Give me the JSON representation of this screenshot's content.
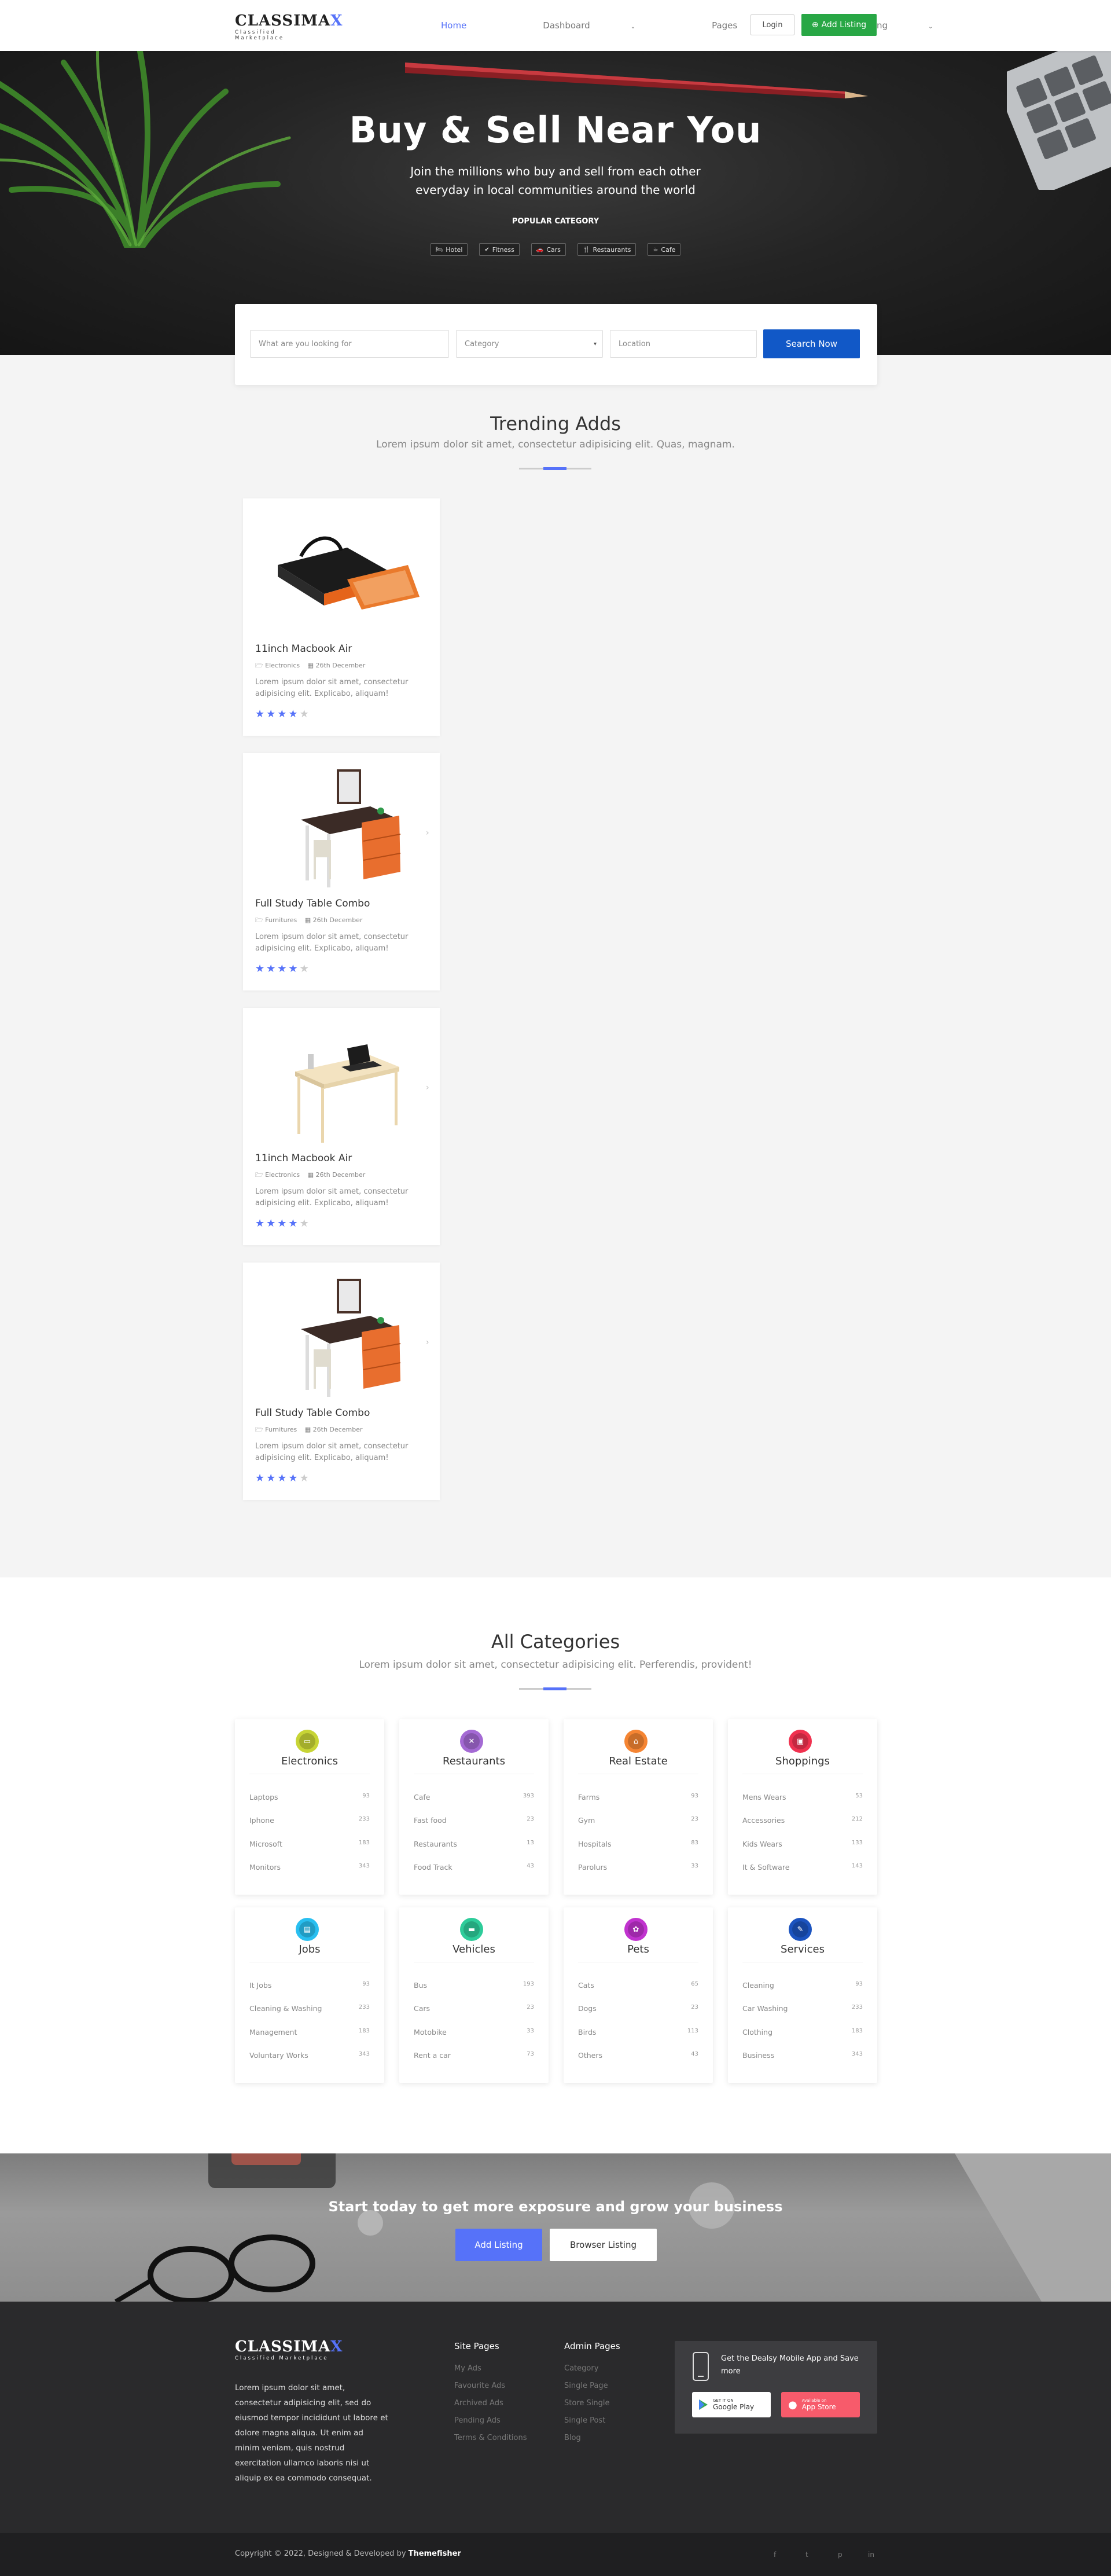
{
  "nav": {
    "logo_main": "CLASSIMA",
    "logo_x": "X",
    "logo_tagline": "Classified Marketplace",
    "items": [
      {
        "label": "Home",
        "caret": ""
      },
      {
        "label": "Dashboard",
        "caret": "⌄"
      },
      {
        "label": "Pages",
        "caret": "⌄"
      },
      {
        "label": "Listing",
        "caret": "⌄"
      }
    ],
    "login": "Login",
    "add_listing": "Add Listing",
    "add_icon": "⊕"
  },
  "hero": {
    "title": "Buy & Sell Near You",
    "subtitle": "Join the millions who buy and sell from each other everyday in local communities around the world",
    "popular_label": "POPULAR CATEGORY",
    "chips": [
      {
        "icon": "🛏",
        "label": "Hotel"
      },
      {
        "icon": "✔",
        "label": "Fitness"
      },
      {
        "icon": "🚗",
        "label": "Cars"
      },
      {
        "icon": "🍴",
        "label": "Restaurants"
      },
      {
        "icon": "☕",
        "label": "Cafe"
      }
    ]
  },
  "search": {
    "keyword_placeholder": "What are you looking for",
    "category_value": "Category",
    "location_placeholder": "Location",
    "button": "Search Now"
  },
  "trending": {
    "title": "Trending Adds",
    "subtitle": "Lorem ipsum dolor sit amet, consectetur adipisicing elit. Quas, magnam.",
    "ads": [
      {
        "title": "11inch Macbook Air",
        "category": "Electronics",
        "date": "26th December",
        "desc": "Lorem ipsum dolor sit amet, consectetur adipisicing elit. Explicabo, aliquam!",
        "rating": 4,
        "image": "bag"
      },
      {
        "title": "Full Study Table Combo",
        "category": "Furnitures",
        "date": "26th December",
        "desc": "Lorem ipsum dolor sit amet, consectetur adipisicing elit. Explicabo, aliquam!",
        "rating": 4,
        "image": "study"
      },
      {
        "title": "11inch Macbook Air",
        "category": "Electronics",
        "date": "26th December",
        "desc": "Lorem ipsum dolor sit amet, consectetur adipisicing elit. Explicabo, aliquam!",
        "rating": 4,
        "image": "desk"
      },
      {
        "title": "Full Study Table Combo",
        "category": "Furnitures",
        "date": "26th December",
        "desc": "Lorem ipsum dolor sit amet, consectetur adipisicing elit. Explicabo, aliquam!",
        "rating": 4,
        "image": "study"
      }
    ]
  },
  "categories": {
    "title": "All Categories",
    "subtitle": "Lorem ipsum dolor sit amet, consectetur adipisicing elit. Perferendis, provident!",
    "items": [
      {
        "name": "Electronics",
        "color": "#c7d435",
        "icon": "laptop-icon",
        "glyph": "▭",
        "rows": [
          [
            "Laptops",
            "93"
          ],
          [
            "Iphone",
            "233"
          ],
          [
            "Microsoft",
            "183"
          ],
          [
            "Monitors",
            "343"
          ]
        ]
      },
      {
        "name": "Restaurants",
        "color": "#a46ad4",
        "icon": "cutlery-icon",
        "glyph": "✕",
        "rows": [
          [
            "Cafe",
            "393"
          ],
          [
            "Fast food",
            "23"
          ],
          [
            "Restaurants",
            "13"
          ],
          [
            "Food Track",
            "43"
          ]
        ]
      },
      {
        "name": "Real Estate",
        "color": "#f58533",
        "icon": "home-icon",
        "glyph": "⌂",
        "rows": [
          [
            "Farms",
            "93"
          ],
          [
            "Gym",
            "23"
          ],
          [
            "Hospitals",
            "83"
          ],
          [
            "Parolurs",
            "33"
          ]
        ]
      },
      {
        "name": "Shoppings",
        "color": "#f0314f",
        "icon": "bag-icon",
        "glyph": "▣",
        "rows": [
          [
            "Mens Wears",
            "53"
          ],
          [
            "Accessories",
            "212"
          ],
          [
            "Kids Wears",
            "133"
          ],
          [
            "It & Software",
            "143"
          ]
        ]
      },
      {
        "name": "Jobs",
        "color": "#29bff0",
        "icon": "briefcase-icon",
        "glyph": "▤",
        "rows": [
          [
            "It Jobs",
            "93"
          ],
          [
            "Cleaning & Washing",
            "233"
          ],
          [
            "Management",
            "183"
          ],
          [
            "Voluntary Works",
            "343"
          ]
        ]
      },
      {
        "name": "Vehicles",
        "color": "#2ecc9a",
        "icon": "car-icon",
        "glyph": "▬",
        "rows": [
          [
            "Bus",
            "193"
          ],
          [
            "Cars",
            "23"
          ],
          [
            "Motobike",
            "33"
          ],
          [
            "Rent a car",
            "73"
          ]
        ]
      },
      {
        "name": "Pets",
        "color": "#c133cf",
        "icon": "paw-icon",
        "glyph": "✿",
        "rows": [
          [
            "Cats",
            "65"
          ],
          [
            "Dogs",
            "23"
          ],
          [
            "Birds",
            "113"
          ],
          [
            "Others",
            "43"
          ]
        ]
      },
      {
        "name": "Services",
        "color": "#1b53bf",
        "icon": "tools-icon",
        "glyph": "✎",
        "rows": [
          [
            "Cleaning",
            "93"
          ],
          [
            "Car Washing",
            "233"
          ],
          [
            "Clothing",
            "183"
          ],
          [
            "Business",
            "343"
          ]
        ]
      }
    ]
  },
  "cta": {
    "title": "Start today to get more exposure and grow your business",
    "primary": "Add Listing",
    "secondary": "Browser Listing"
  },
  "footer": {
    "description": "Lorem ipsum dolor sit amet, consectetur adipisicing elit, sed do eiusmod tempor incididunt ut labore et dolore magna aliqua. Ut enim ad minim veniam, quis nostrud exercitation ullamco laboris nisi ut aliquip ex ea commodo consequat.",
    "site_pages_title": "Site Pages",
    "site_pages": [
      "My Ads",
      "Favourite Ads",
      "Archived Ads",
      "Pending Ads",
      "Terms & Conditions"
    ],
    "admin_pages_title": "Admin Pages",
    "admin_pages": [
      "Category",
      "Single Page",
      "Store Single",
      "Single Post",
      "Blog"
    ],
    "app_text": "Get the Dealsy Mobile App and Save more",
    "google_small": "GET IT ON",
    "google_big": "Google Play",
    "apple_small": "Available on",
    "apple_big": "App Store",
    "copyright": "Copyright © 2022, Designed & Developed by ",
    "copyright_brand": "Themefisher",
    "social": [
      "f",
      "t",
      "p",
      "in"
    ]
  }
}
